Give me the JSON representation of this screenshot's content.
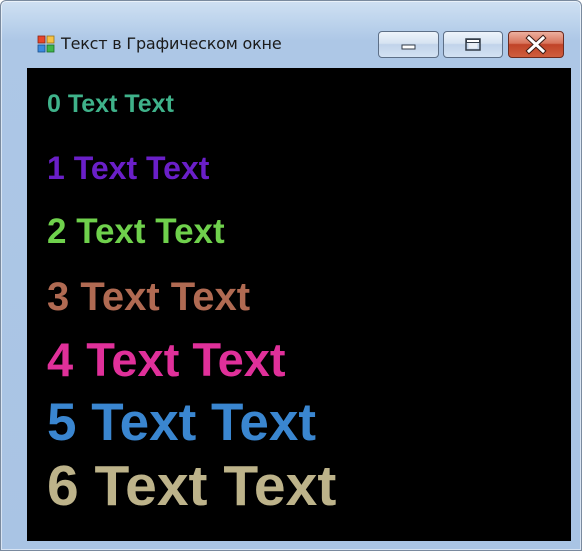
{
  "window": {
    "title": "Текст в Графическом окне",
    "controls": {
      "minimize": "minimize",
      "maximize": "maximize",
      "close": "close"
    }
  },
  "canvas": {
    "background": "#000000",
    "lines": [
      {
        "text": "0 Text Text",
        "color": "#3fb28a"
      },
      {
        "text": "1 Text Text",
        "color": "#6a1fc8"
      },
      {
        "text": "2 Text Text",
        "color": "#6fd14c"
      },
      {
        "text": "3 Text Text",
        "color": "#b06a52"
      },
      {
        "text": "4 Text Text",
        "color": "#e0309a"
      },
      {
        "text": "5 Text Text",
        "color": "#3a86d0"
      },
      {
        "text": "6 Text Text",
        "color": "#bdb38a"
      }
    ]
  }
}
